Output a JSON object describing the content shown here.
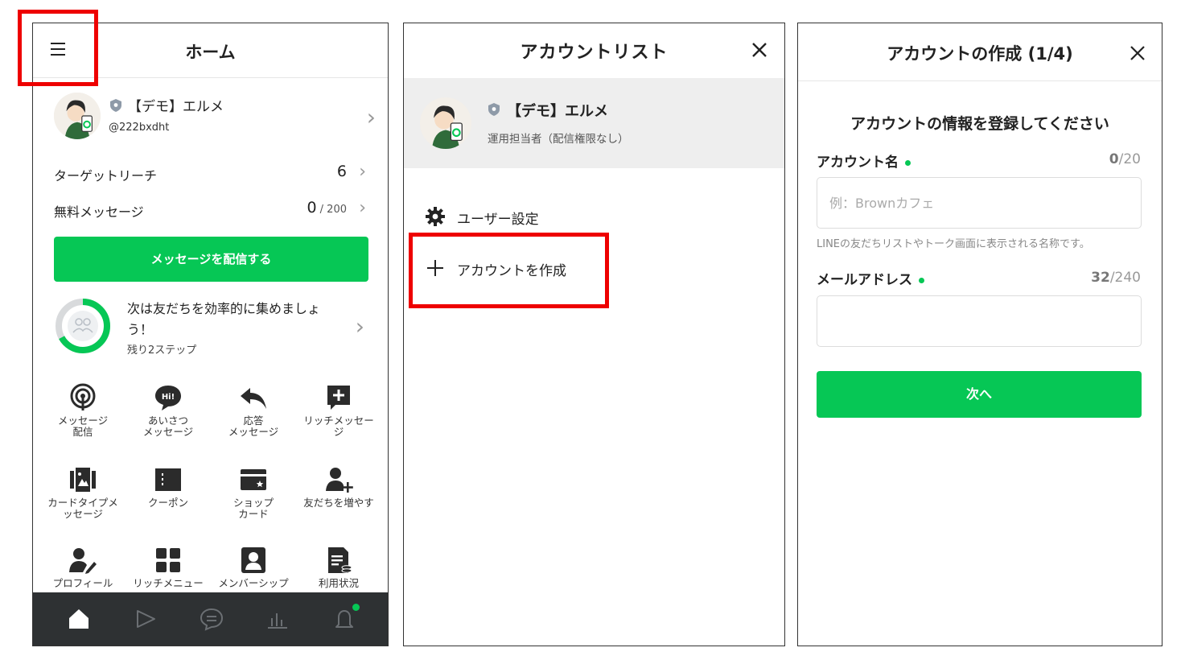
{
  "colors": {
    "accent_green": "#06c755",
    "highlight_red": "#ee0000",
    "tabbar_bg": "#2e3133"
  },
  "home": {
    "title": "ホーム",
    "account": {
      "name": "【デモ】エルメ",
      "id": "@222bxdht"
    },
    "stats": [
      {
        "label": "ターゲットリーチ",
        "value": "6",
        "suffix": ""
      },
      {
        "label": "無料メッセージ",
        "value": "0",
        "suffix": " / 200"
      }
    ],
    "broadcast_button": "メッセージを配信する",
    "steps": {
      "text": "次は友だちを効率的に集めましょう！",
      "sub": "残り2ステップ",
      "progress_fraction": 0.67
    },
    "grid": [
      {
        "label": "メッセージ\n配信",
        "icon": "broadcast-icon"
      },
      {
        "label": "あいさつ\nメッセージ",
        "icon": "greeting-icon"
      },
      {
        "label": "応答\nメッセージ",
        "icon": "reply-icon"
      },
      {
        "label": "リッチメッセー\nジ",
        "icon": "rich-message-icon"
      },
      {
        "label": "カードタイプメ\nッセージ",
        "icon": "card-message-icon"
      },
      {
        "label": "クーポン",
        "icon": "coupon-icon"
      },
      {
        "label": "ショップ\nカード",
        "icon": "shop-card-icon"
      },
      {
        "label": "友だちを増やす",
        "icon": "add-friend-icon"
      },
      {
        "label": "プロフィール",
        "icon": "profile-icon"
      },
      {
        "label": "リッチメニュー",
        "icon": "rich-menu-icon"
      },
      {
        "label": "メンバーシップ",
        "icon": "membership-icon"
      },
      {
        "label": "利用状況",
        "icon": "usage-icon"
      }
    ],
    "tabs": [
      "home-icon",
      "play-icon",
      "chat-icon",
      "analytics-icon",
      "bell-icon"
    ]
  },
  "account_list": {
    "title": "アカウントリスト",
    "account": {
      "name": "【デモ】エルメ",
      "role": "運用担当者（配信権限なし）"
    },
    "menu": {
      "user_settings": "ユーザー設定",
      "create_account": "アカウントを作成"
    }
  },
  "create_account": {
    "title": "アカウントの作成 (1/4)",
    "lead": "アカウントの情報を登録してください",
    "name_field": {
      "label": "アカウント名",
      "count": "0",
      "max": "/20",
      "placeholder": "例：Brownカフェ",
      "hint": "LINEの友だちリストやトーク画面に表示される名称です。"
    },
    "email_field": {
      "label": "メールアドレス",
      "count": "32",
      "max": "/240",
      "value": ""
    },
    "next_button": "次へ"
  }
}
